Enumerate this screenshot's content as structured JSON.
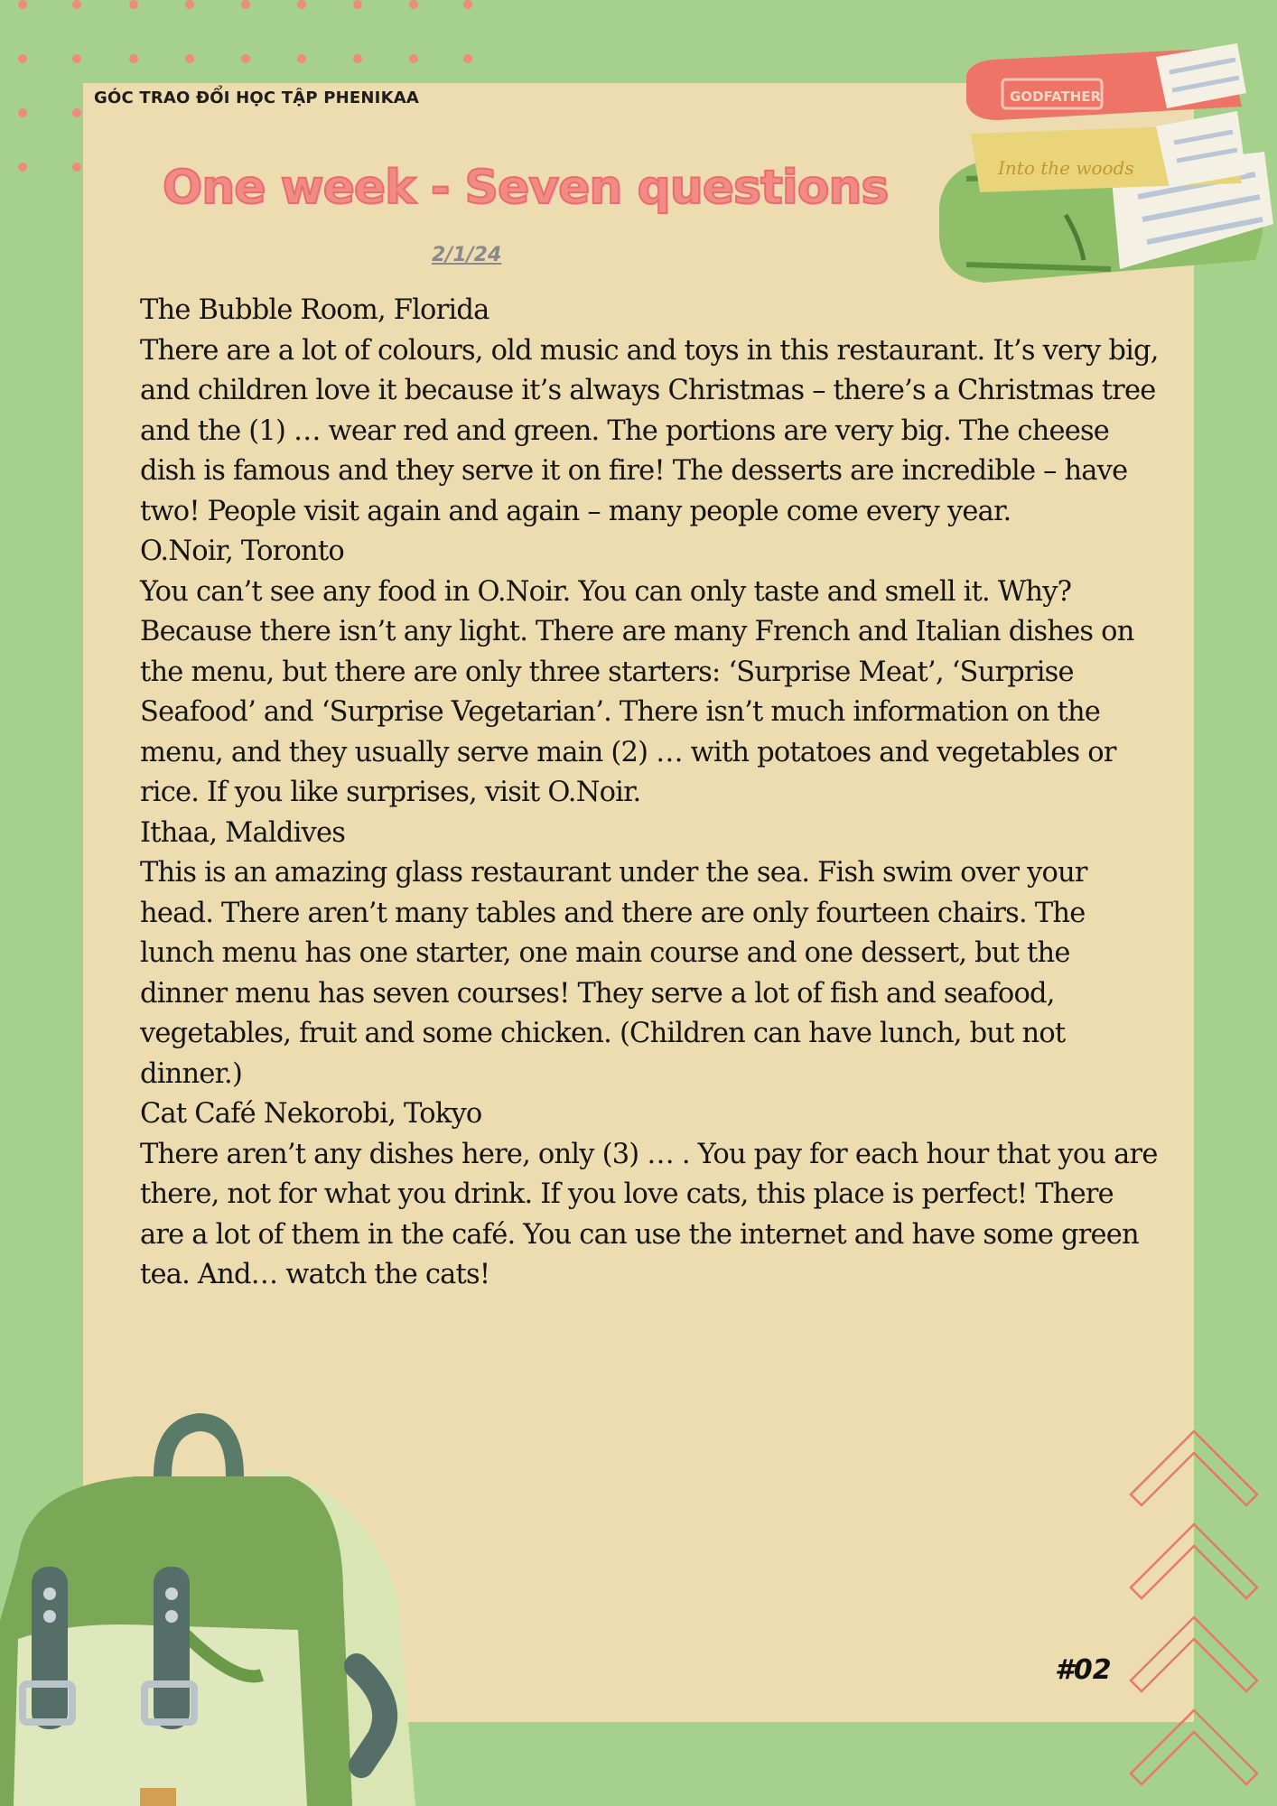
{
  "header": {
    "label": "GÓC TRAO ĐỔI HỌC TẬP PHENIKAA",
    "title": "One week  - Seven questions",
    "date": "2/1/24"
  },
  "decorations": {
    "books_icon": "stacked-books-icon",
    "book_titles": [
      "GODFATHER",
      "Into the woods"
    ],
    "backpack_icon": "backpack-icon",
    "chevron_icon": "chevron-up-icon",
    "colors": {
      "background": "#a5d18c",
      "paper": "#eddcb0",
      "accent": "#f28a86",
      "dots": "#f08a7c"
    }
  },
  "article": {
    "sections": [
      {
        "heading": "The Bubble Room, Florida",
        "body": "There are a lot of colours, old music and toys in this restaurant. It’s very big, and children love it because it’s always Christmas – there’s a Christmas tree and the (1) … wear red and green. The portions are very big. The cheese dish is famous and they serve it on fire! The desserts are incredible – have two! People visit again and again – many people come every year."
      },
      {
        "heading": "O.Noir, Toronto",
        "body": "You can’t see any food in O.Noir. You can only taste and smell it. Why? Because there isn’t any light. There are many French and Italian dishes on the menu, but there are only three starters: ‘Surprise Meat’, ‘Surprise Seafood’ and ‘Surprise Vegetarian’. There isn’t much information on the menu, and they usually serve main (2) … with potatoes and vegetables or rice. If you like surprises, visit O.Noir."
      },
      {
        "heading": "Ithaa, Maldives",
        "body": "This is an amazing glass restaurant under the sea. Fish swim over your head. There aren’t many tables and there are only fourteen chairs. The lunch menu has one starter, one main course and one dessert, but the dinner menu has seven courses! They serve a lot of fish and seafood, vegetables, fruit and some chicken. (Children can have lunch, but not dinner.)"
      },
      {
        "heading": "Cat Café Nekorobi, Tokyo",
        "body": "There aren’t any dishes here, only (3) … . You pay for each hour that you are there, not for what you drink. If you love cats, this place is perfect! There are a lot of them in the café. You can use the internet and have some green tea. And… watch the cats!"
      }
    ]
  },
  "footer": {
    "page_number": "#02"
  }
}
